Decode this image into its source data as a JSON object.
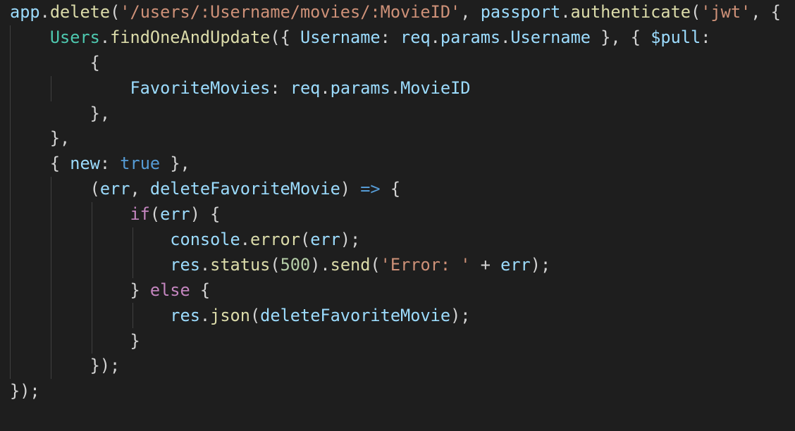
{
  "editor": {
    "theme": "dark",
    "colors": {
      "background": "#1e1e1e",
      "text": "#d4d4d4",
      "variable": "#9cdcfe",
      "function": "#dcdcaa",
      "string": "#ce9178",
      "class": "#4ec9b0",
      "keyword": "#569cd6",
      "control": "#c586c0",
      "number": "#b5cea8",
      "indent_guide": "#404040"
    },
    "lines": [
      [
        {
          "t": "app",
          "c": "tok-mod"
        },
        {
          "t": ".",
          "c": "tok-op"
        },
        {
          "t": "delete",
          "c": "tok-fn"
        },
        {
          "t": "(",
          "c": "tok-op"
        },
        {
          "t": "'/users/:Username/movies/:MovieID'",
          "c": "tok-str"
        },
        {
          "t": ", ",
          "c": "tok-op"
        },
        {
          "t": "passport",
          "c": "tok-mod"
        },
        {
          "t": ".",
          "c": "tok-op"
        },
        {
          "t": "authenticate",
          "c": "tok-fn"
        },
        {
          "t": "(",
          "c": "tok-op"
        },
        {
          "t": "'jwt'",
          "c": "tok-str"
        },
        {
          "t": ", {",
          "c": "tok-op"
        }
      ],
      [
        {
          "t": "    ",
          "c": "tok-op"
        },
        {
          "t": "Users",
          "c": "tok-cls"
        },
        {
          "t": ".",
          "c": "tok-op"
        },
        {
          "t": "findOneAndUpdate",
          "c": "tok-fn"
        },
        {
          "t": "({ ",
          "c": "tok-op"
        },
        {
          "t": "Username",
          "c": "tok-prop"
        },
        {
          "t": ": ",
          "c": "tok-op"
        },
        {
          "t": "req",
          "c": "tok-mod"
        },
        {
          "t": ".",
          "c": "tok-op"
        },
        {
          "t": "params",
          "c": "tok-mod"
        },
        {
          "t": ".",
          "c": "tok-op"
        },
        {
          "t": "Username",
          "c": "tok-mod"
        },
        {
          "t": " }, { ",
          "c": "tok-op"
        },
        {
          "t": "$pull",
          "c": "tok-prop"
        },
        {
          "t": ":",
          "c": "tok-op"
        }
      ],
      [
        {
          "t": "        {",
          "c": "tok-op"
        }
      ],
      [
        {
          "t": "            ",
          "c": "tok-op"
        },
        {
          "t": "FavoriteMovies",
          "c": "tok-prop"
        },
        {
          "t": ": ",
          "c": "tok-op"
        },
        {
          "t": "req",
          "c": "tok-mod"
        },
        {
          "t": ".",
          "c": "tok-op"
        },
        {
          "t": "params",
          "c": "tok-mod"
        },
        {
          "t": ".",
          "c": "tok-op"
        },
        {
          "t": "MovieID",
          "c": "tok-mod"
        }
      ],
      [
        {
          "t": "        },",
          "c": "tok-op"
        }
      ],
      [
        {
          "t": "    },",
          "c": "tok-op"
        }
      ],
      [
        {
          "t": "    { ",
          "c": "tok-op"
        },
        {
          "t": "new",
          "c": "tok-prop"
        },
        {
          "t": ": ",
          "c": "tok-op"
        },
        {
          "t": "true",
          "c": "tok-kw"
        },
        {
          "t": " },",
          "c": "tok-op"
        }
      ],
      [
        {
          "t": "        (",
          "c": "tok-op"
        },
        {
          "t": "err",
          "c": "tok-mod"
        },
        {
          "t": ", ",
          "c": "tok-op"
        },
        {
          "t": "deleteFavoriteMovie",
          "c": "tok-mod"
        },
        {
          "t": ") ",
          "c": "tok-op"
        },
        {
          "t": "=>",
          "c": "tok-arrow"
        },
        {
          "t": " {",
          "c": "tok-op"
        }
      ],
      [
        {
          "t": "            ",
          "c": "tok-op"
        },
        {
          "t": "if",
          "c": "tok-ctl"
        },
        {
          "t": "(",
          "c": "tok-op"
        },
        {
          "t": "err",
          "c": "tok-mod"
        },
        {
          "t": ") {",
          "c": "tok-op"
        }
      ],
      [
        {
          "t": "                ",
          "c": "tok-op"
        },
        {
          "t": "console",
          "c": "tok-mod"
        },
        {
          "t": ".",
          "c": "tok-op"
        },
        {
          "t": "error",
          "c": "tok-fn"
        },
        {
          "t": "(",
          "c": "tok-op"
        },
        {
          "t": "err",
          "c": "tok-mod"
        },
        {
          "t": ");",
          "c": "tok-op"
        }
      ],
      [
        {
          "t": "                ",
          "c": "tok-op"
        },
        {
          "t": "res",
          "c": "tok-mod"
        },
        {
          "t": ".",
          "c": "tok-op"
        },
        {
          "t": "status",
          "c": "tok-fn"
        },
        {
          "t": "(",
          "c": "tok-op"
        },
        {
          "t": "500",
          "c": "tok-num"
        },
        {
          "t": ").",
          "c": "tok-op"
        },
        {
          "t": "send",
          "c": "tok-fn"
        },
        {
          "t": "(",
          "c": "tok-op"
        },
        {
          "t": "'Error: '",
          "c": "tok-str"
        },
        {
          "t": " + ",
          "c": "tok-op"
        },
        {
          "t": "err",
          "c": "tok-mod"
        },
        {
          "t": ");",
          "c": "tok-op"
        }
      ],
      [
        {
          "t": "            } ",
          "c": "tok-op"
        },
        {
          "t": "else",
          "c": "tok-ctl"
        },
        {
          "t": " {",
          "c": "tok-op"
        }
      ],
      [
        {
          "t": "                ",
          "c": "tok-op"
        },
        {
          "t": "res",
          "c": "tok-mod"
        },
        {
          "t": ".",
          "c": "tok-op"
        },
        {
          "t": "json",
          "c": "tok-fn"
        },
        {
          "t": "(",
          "c": "tok-op"
        },
        {
          "t": "deleteFavoriteMovie",
          "c": "tok-mod"
        },
        {
          "t": ");",
          "c": "tok-op"
        }
      ],
      [
        {
          "t": "            }",
          "c": "tok-op"
        }
      ],
      [
        {
          "t": "        });",
          "c": "tok-op"
        }
      ],
      [
        {
          "t": "});",
          "c": "tok-op"
        }
      ]
    ]
  }
}
